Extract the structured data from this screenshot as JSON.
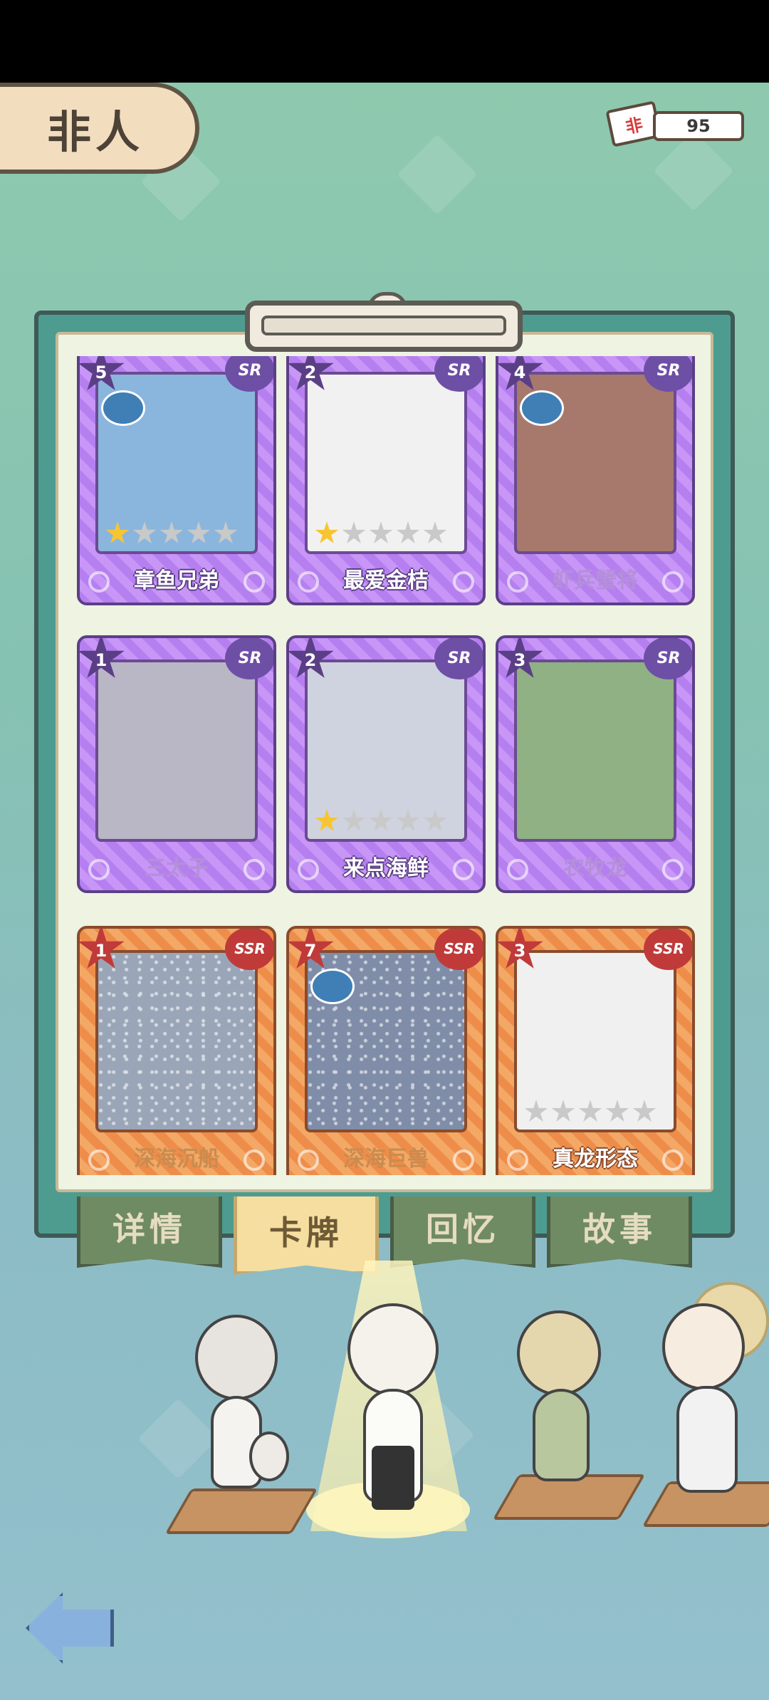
{
  "header": {
    "title": "非人",
    "ticket_icon_text": "非",
    "ticket_count": "95"
  },
  "cards": [
    {
      "name": "章鱼兄弟",
      "rate": "5",
      "rarity": "SR",
      "stars_on": 1,
      "stars_total": 5,
      "locked": false,
      "art_color": "#8ab6de"
    },
    {
      "name": "最爱金桔",
      "rate": "2",
      "rarity": "SR",
      "stars_on": 1,
      "stars_total": 5,
      "locked": false,
      "art_color": "#f1f1f1"
    },
    {
      "name": "虾兵蟹将",
      "rate": "4",
      "rarity": "SR",
      "stars_on": 0,
      "stars_total": 0,
      "locked": true,
      "art_color": "#a7796c"
    },
    {
      "name": "三太子",
      "rate": "1",
      "rarity": "SR",
      "stars_on": 0,
      "stars_total": 0,
      "locked": true,
      "art_color": "#b9b6c5"
    },
    {
      "name": "来点海鲜",
      "rate": "2",
      "rarity": "SR",
      "stars_on": 1,
      "stars_total": 5,
      "locked": false,
      "art_color": "#cfd3df"
    },
    {
      "name": "农牧龙",
      "rate": "3",
      "rarity": "SR",
      "stars_on": 0,
      "stars_total": 0,
      "locked": true,
      "art_color": "#8fb183"
    },
    {
      "name": "深海沉船",
      "rate": "1",
      "rarity": "SSR",
      "stars_on": 0,
      "stars_total": 0,
      "locked": true,
      "art_color": "#9aa6b8"
    },
    {
      "name": "深海巨兽",
      "rate": "7",
      "rarity": "SSR",
      "stars_on": 0,
      "stars_total": 0,
      "locked": true,
      "art_color": "#7f8da8"
    },
    {
      "name": "真龙形态",
      "rate": "3",
      "rarity": "SSR",
      "stars_on": 0,
      "stars_total": 5,
      "locked": false,
      "art_color": "#f0f0f0"
    }
  ],
  "tabs": [
    {
      "label": "详情",
      "active": false
    },
    {
      "label": "卡牌",
      "active": true
    },
    {
      "label": "回忆",
      "active": false
    },
    {
      "label": "故事",
      "active": false
    }
  ],
  "characters": [
    {
      "name": "white-bear-girl",
      "color": "#e9e6e2"
    },
    {
      "name": "dragon-man",
      "color": "#f3f0ea"
    },
    {
      "name": "rabbit-girl",
      "color": "#d9cfa7"
    },
    {
      "name": "suit-man",
      "color": "#f2f2f2"
    }
  ],
  "colors": {
    "sr_frame": "#b57ff0",
    "ssr_frame": "#ee8d4a",
    "star_on": "#f7c531",
    "tab_active": "#f5dea0",
    "tab_inactive": "#6f8b64"
  }
}
